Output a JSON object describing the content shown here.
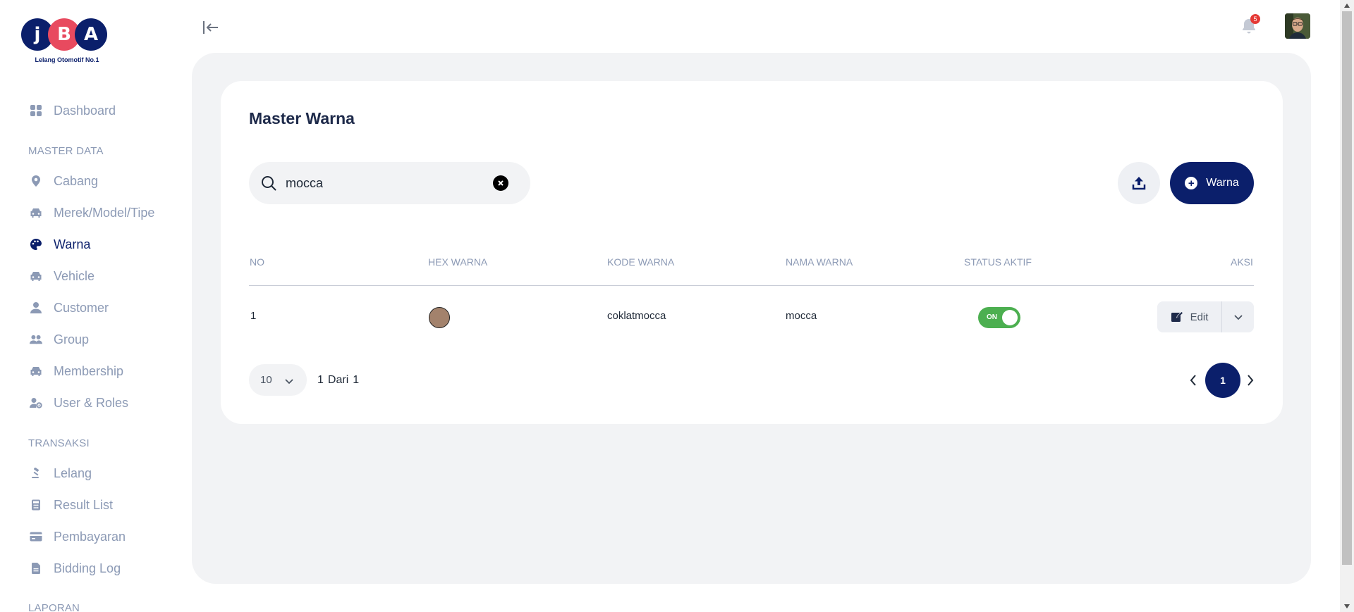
{
  "brand": {
    "letters": [
      "j",
      "B",
      "A"
    ],
    "tagline": "Lelang Otomotif No.1",
    "colors": {
      "navy": "#0b1f6b",
      "red": "#e84a5f"
    }
  },
  "sidebar": {
    "items": [
      {
        "label": "Dashboard",
        "icon": "grid-icon"
      }
    ],
    "sections": [
      {
        "title": "MASTER DATA",
        "items": [
          {
            "label": "Cabang",
            "icon": "location-pin-icon"
          },
          {
            "label": "Merek/Model/Tipe",
            "icon": "car-icon"
          },
          {
            "label": "Warna",
            "icon": "palette-icon",
            "active": true
          },
          {
            "label": "Vehicle",
            "icon": "car-icon"
          },
          {
            "label": "Customer",
            "icon": "user-icon"
          },
          {
            "label": "Group",
            "icon": "users-icon"
          },
          {
            "label": "Membership",
            "icon": "car-icon"
          },
          {
            "label": "User & Roles",
            "icon": "user-cog-icon"
          }
        ]
      },
      {
        "title": "TRANSAKSI",
        "items": [
          {
            "label": "Lelang",
            "icon": "gavel-icon"
          },
          {
            "label": "Result List",
            "icon": "calculator-icon"
          },
          {
            "label": "Pembayaran",
            "icon": "credit-card-icon"
          },
          {
            "label": "Bidding Log",
            "icon": "document-icon"
          }
        ]
      },
      {
        "title": "LAPORAN",
        "items": []
      }
    ]
  },
  "header": {
    "notification_count": "5"
  },
  "page": {
    "title": "Master Warna",
    "search": {
      "value": "mocca",
      "placeholder": ""
    },
    "add_button_label": "Warna"
  },
  "table": {
    "columns": [
      "NO",
      "HEX WARNA",
      "KODE WARNA",
      "NAMA WARNA",
      "STATUS AKTIF",
      "AKSI"
    ],
    "rows": [
      {
        "no": "1",
        "hex": "#a3826c",
        "kode": "coklatmocca",
        "nama": "mocca",
        "status": "ON",
        "action": "Edit"
      }
    ]
  },
  "pagination": {
    "per_page": "10",
    "current": "1",
    "of_label": "Dari",
    "total": "1",
    "page_button": "1"
  }
}
